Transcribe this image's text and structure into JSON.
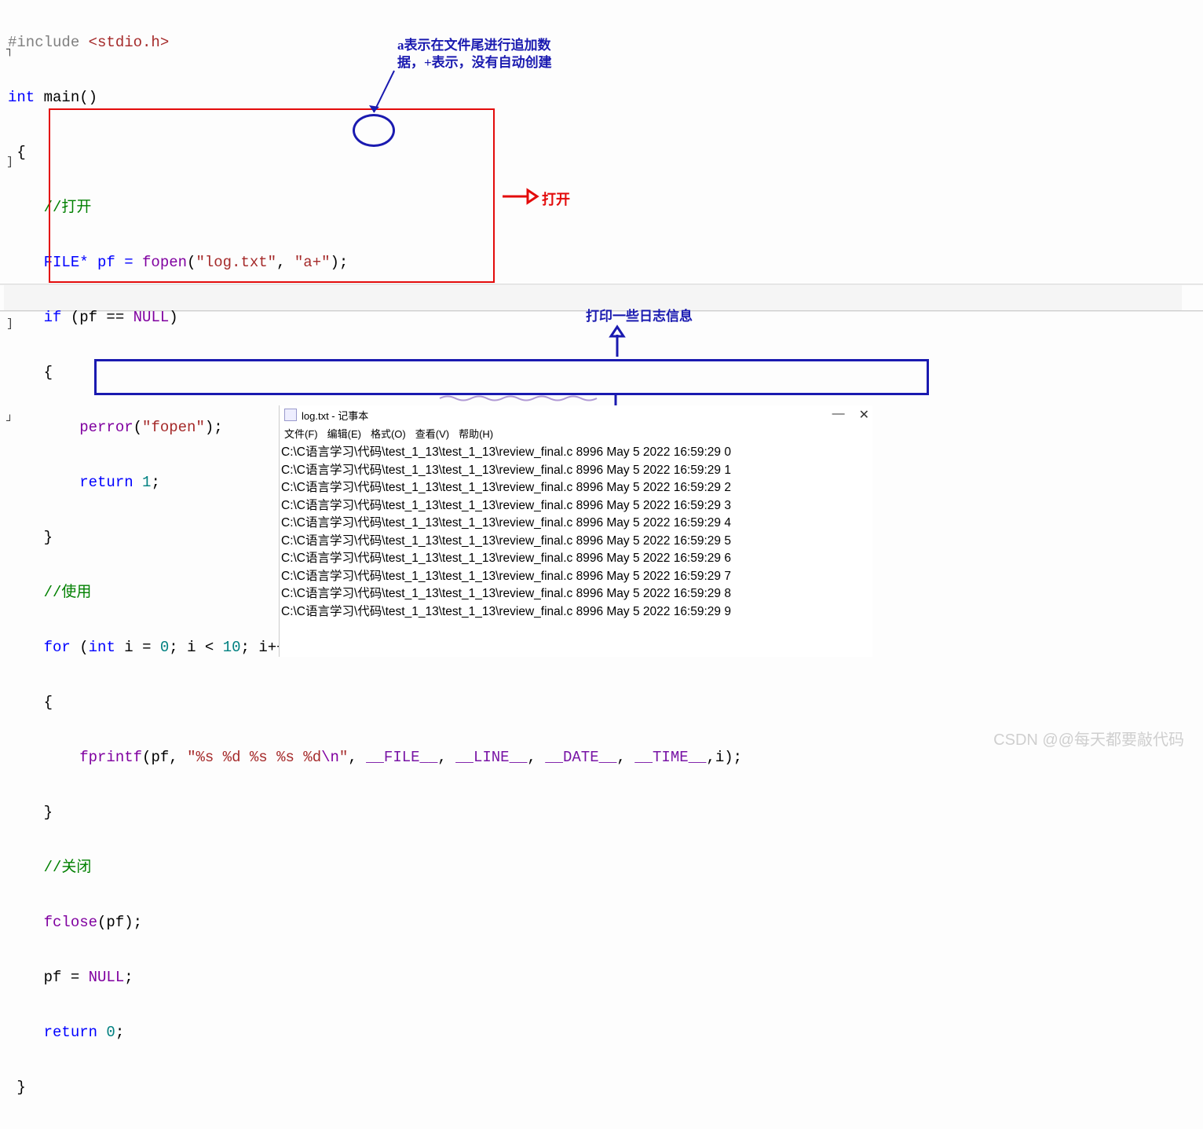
{
  "annotations": {
    "top_note_l1": "a表示在文件尾进行追加数",
    "top_note_l2": "据，+表示，没有自动创建",
    "right_red": "打开",
    "mid_blue": "打印一些日志信息"
  },
  "code": {
    "l1_a": "#include",
    "l1_b": " <stdio.h>",
    "l2_a": "int",
    "l2_b": " main()",
    "l3": " {",
    "l4": "    //打开",
    "l5_a": "    FILE* pf = ",
    "l5_b": "fopen",
    "l5_c": "(",
    "l5_d": "\"log.txt\"",
    "l5_e": ", ",
    "l5_f": "\"a+\"",
    "l5_g": ");",
    "l6_a": "    if",
    "l6_b": " (pf == ",
    "l6_c": "NULL",
    "l6_d": ")",
    "l7": "    {",
    "l8_a": "        ",
    "l8_b": "perror",
    "l8_c": "(",
    "l8_d": "\"fopen\"",
    "l8_e": ");",
    "l9_a": "        return",
    "l9_b": " 1",
    "l9_c": ";",
    "l10": "    }",
    "l11": "    //使用",
    "l12_a": "    for",
    "l12_b": " (",
    "l12_c": "int",
    "l12_d": " i = ",
    "l12_e": "0",
    "l12_f": "; i < ",
    "l12_g": "10",
    "l12_h": "; i++)",
    "l13": "    {",
    "l14_a": "        ",
    "l14_b": "fprintf",
    "l14_c": "(pf, ",
    "l14_d": "\"%s %d %s %s %d",
    "l14_e": "\\n",
    "l14_f": "\"",
    "l14_g": ", ",
    "l14_h": "__FILE__",
    "l14_i": ", ",
    "l14_j": "__LINE__",
    "l14_k": ", ",
    "l14_l": "__DATE__",
    "l14_m": ", ",
    "l14_n": "__TIME__",
    "l14_o": ",i);",
    "l15": "    }",
    "l16": "    //关闭",
    "l17_a": "    ",
    "l17_b": "fclose",
    "l17_c": "(pf);",
    "l18": "    pf = ",
    "l18_b": "NULL",
    "l18_c": ";",
    "l19_a": "    return",
    "l19_b": " 0",
    "l19_c": ";",
    "l20": " }"
  },
  "notepad": {
    "title": "log.txt - 记事本",
    "menu": [
      "文件(F)",
      "编辑(E)",
      "格式(O)",
      "查看(V)",
      "帮助(H)"
    ],
    "lines": [
      "C:\\C语言学习\\代码\\test_1_13\\test_1_13\\review_final.c 8996 May  5 2022 16:59:29 0",
      "C:\\C语言学习\\代码\\test_1_13\\test_1_13\\review_final.c 8996 May  5 2022 16:59:29 1",
      "C:\\C语言学习\\代码\\test_1_13\\test_1_13\\review_final.c 8996 May  5 2022 16:59:29 2",
      "C:\\C语言学习\\代码\\test_1_13\\test_1_13\\review_final.c 8996 May  5 2022 16:59:29 3",
      "C:\\C语言学习\\代码\\test_1_13\\test_1_13\\review_final.c 8996 May  5 2022 16:59:29 4",
      "C:\\C语言学习\\代码\\test_1_13\\test_1_13\\review_final.c 8996 May  5 2022 16:59:29 5",
      "C:\\C语言学习\\代码\\test_1_13\\test_1_13\\review_final.c 8996 May  5 2022 16:59:29 6",
      "C:\\C语言学习\\代码\\test_1_13\\test_1_13\\review_final.c 8996 May  5 2022 16:59:29 7",
      "C:\\C语言学习\\代码\\test_1_13\\test_1_13\\review_final.c 8996 May  5 2022 16:59:29 8",
      "C:\\C语言学习\\代码\\test_1_13\\test_1_13\\review_final.c 8996 May  5 2022 16:59:29 9"
    ],
    "ctrl_min": "—",
    "ctrl_close": "✕"
  },
  "watermark": "CSDN @@每天都要敲代码"
}
